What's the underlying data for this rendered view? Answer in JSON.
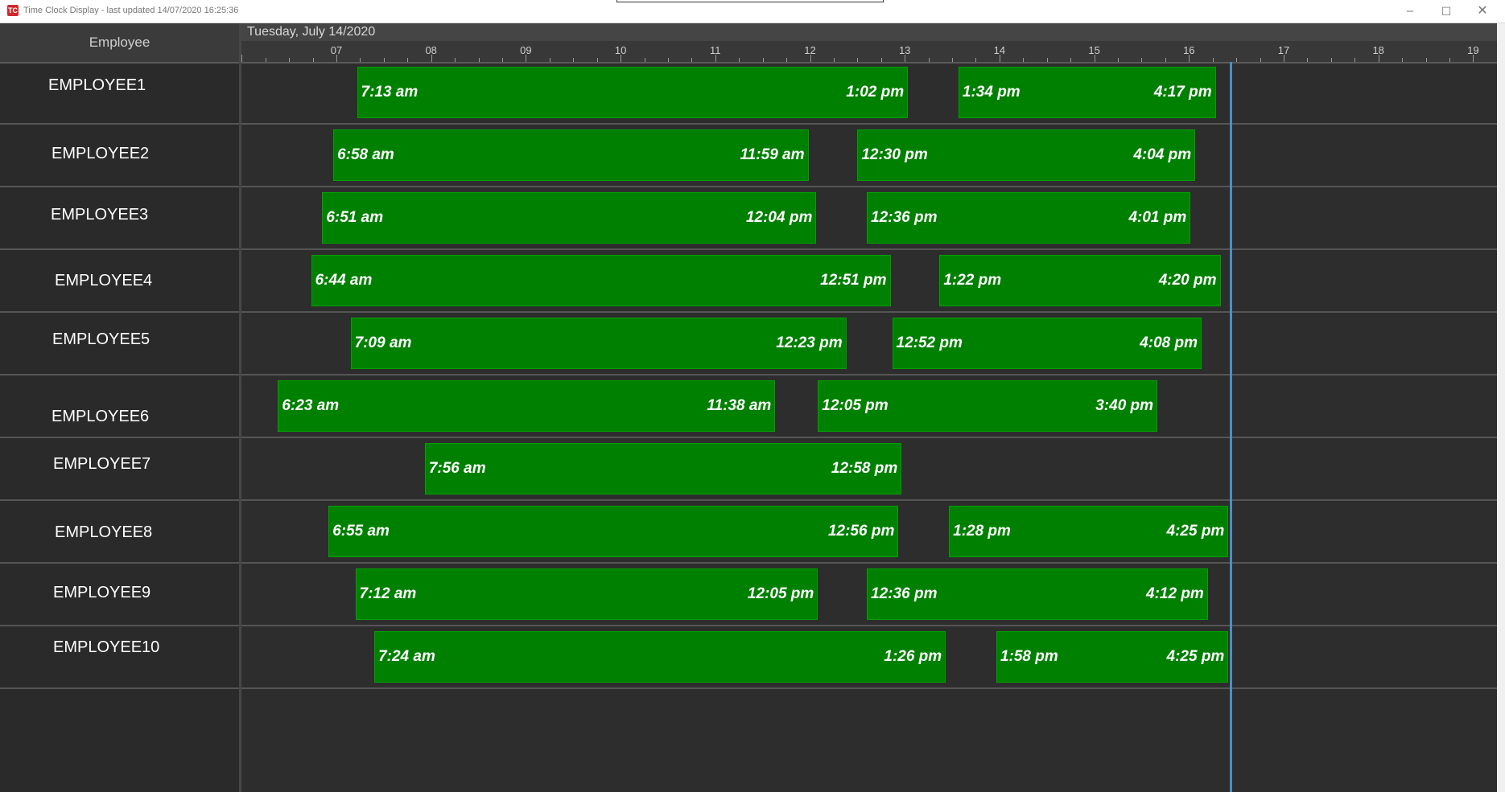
{
  "window": {
    "app_icon_glyph": "TC",
    "title": "Time Clock Display - last updated 14/07/2020 16:25:36",
    "minimize_glyph": "–",
    "maximize_glyph": "☐",
    "close_glyph": "✕"
  },
  "panel": {
    "employee_header": "Employee"
  },
  "timeline": {
    "date": "Tuesday, July 14/2020",
    "hours": [
      "07",
      "08",
      "09",
      "10",
      "11",
      "12",
      "13",
      "14",
      "15",
      "16",
      "17",
      "18",
      "19"
    ],
    "current_time": "16:25:36"
  },
  "colors": {
    "bar_fill": "#008000",
    "now_line": "#4a8fc7",
    "background": "#2d2d2d"
  },
  "employees": [
    {
      "name": "EMPLOYEE1",
      "shifts": [
        {
          "in": "7:13 am",
          "out": "1:02 pm"
        },
        {
          "in": "1:34 pm",
          "out": "4:17 pm"
        }
      ]
    },
    {
      "name": "EMPLOYEE2",
      "shifts": [
        {
          "in": "6:58 am",
          "out": "11:59 am"
        },
        {
          "in": "12:30 pm",
          "out": "4:04 pm"
        }
      ]
    },
    {
      "name": "EMPLOYEE3",
      "shifts": [
        {
          "in": "6:51 am",
          "out": "12:04 pm"
        },
        {
          "in": "12:36 pm",
          "out": "4:01 pm"
        }
      ]
    },
    {
      "name": "EMPLOYEE4",
      "shifts": [
        {
          "in": "6:44 am",
          "out": "12:51 pm"
        },
        {
          "in": "1:22 pm",
          "out": "4:20 pm"
        }
      ]
    },
    {
      "name": "EMPLOYEE5",
      "shifts": [
        {
          "in": "7:09 am",
          "out": "12:23 pm"
        },
        {
          "in": "12:52 pm",
          "out": "4:08 pm"
        }
      ]
    },
    {
      "name": "EMPLOYEE6",
      "shifts": [
        {
          "in": "6:23 am",
          "out": "11:38 am"
        },
        {
          "in": "12:05 pm",
          "out": "3:40 pm"
        }
      ]
    },
    {
      "name": "EMPLOYEE7",
      "shifts": [
        {
          "in": "7:56 am",
          "out": "12:58 pm"
        }
      ]
    },
    {
      "name": "EMPLOYEE8",
      "shifts": [
        {
          "in": "6:55 am",
          "out": "12:56 pm"
        },
        {
          "in": "1:28 pm",
          "out": "4:25 pm"
        }
      ]
    },
    {
      "name": "EMPLOYEE9",
      "shifts": [
        {
          "in": "7:12 am",
          "out": "12:05 pm"
        },
        {
          "in": "12:36 pm",
          "out": "4:12 pm"
        }
      ]
    },
    {
      "name": "EMPLOYEE10",
      "shifts": [
        {
          "in": "7:24 am",
          "out": "1:26 pm"
        },
        {
          "in": "1:58 pm",
          "out": "4:25 pm"
        }
      ]
    }
  ]
}
